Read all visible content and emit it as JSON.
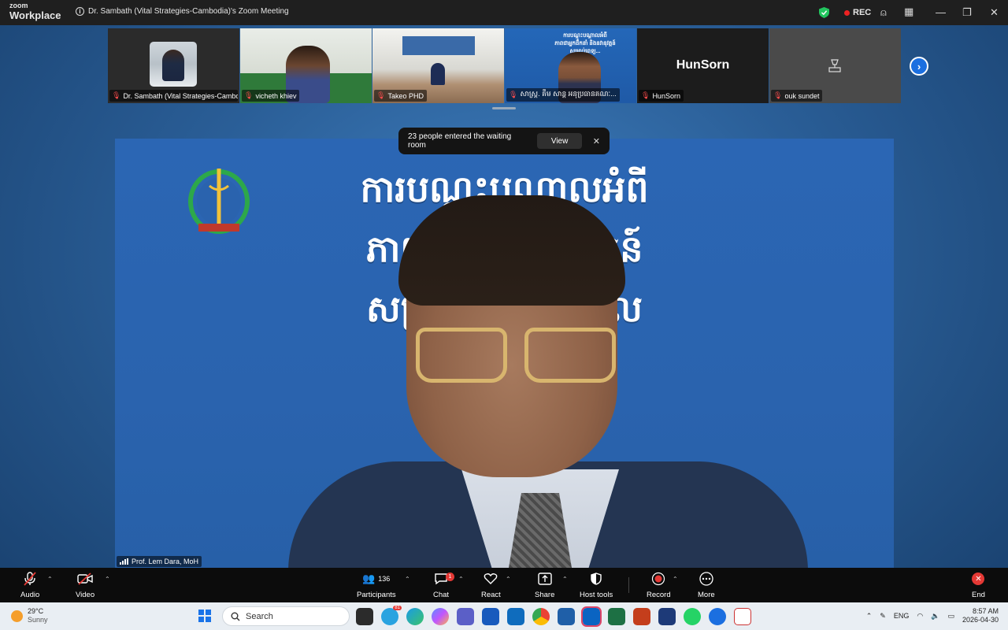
{
  "window": {
    "brand_top": "zoom",
    "brand_bottom": "Workplace",
    "title": "Dr. Sambath (Vital Strategies-Cambodia)'s Zoom Meeting",
    "rec_label": "REC"
  },
  "thumbnails": [
    {
      "name": "Dr. Sambath (Vital Strategies-Cambodia)"
    },
    {
      "name": "vicheth khiev"
    },
    {
      "name": "Takeo PHD"
    },
    {
      "name": "សាស្ត្រ. គឹម សាន្ត អនុប្រធានគណៈ..."
    },
    {
      "name": "HunSorn",
      "display_name": "HunSorn"
    },
    {
      "name": "ouk sundet"
    }
  ],
  "thumb4_slide_text": [
    "ការបណ្ដុះបណ្ដាលអំពី",
    "ភាពជាអ្នកដឹកនាំ និងនវានុវត្តន៍",
    "សម្រាប់ពេទ្យ...",
    "...អភិបាល"
  ],
  "notification": {
    "text": "23 people entered the waiting room",
    "view_label": "View",
    "close_icon": "✕"
  },
  "speaker": {
    "name": "Prof. Lem Dara, MoH",
    "slide_lines": [
      "ការបណ្ដុះបណ្ដាលអំពី",
      "ភាពជាអ្នក                    នវានុវត្តន៍",
      "សម្រាប់              សុខាភិបាល"
    ]
  },
  "toolbar": {
    "audio": "Audio",
    "video": "Video",
    "participants": "Participants",
    "participant_count": "136",
    "chat": "Chat",
    "chat_badge": "1",
    "react": "React",
    "share": "Share",
    "host_tools": "Host tools",
    "record": "Record",
    "more": "More",
    "end": "End"
  },
  "taskbar": {
    "temperature": "29°C",
    "condition": "Sunny",
    "search_placeholder": "Search",
    "telegram_badge": "81",
    "language": "ENG",
    "time": "8:57 AM",
    "date": "2026-04-30"
  },
  "colors": {
    "accent": "#1b6fe0",
    "end_red": "#e53935",
    "slide_blue": "#2a63ae"
  }
}
